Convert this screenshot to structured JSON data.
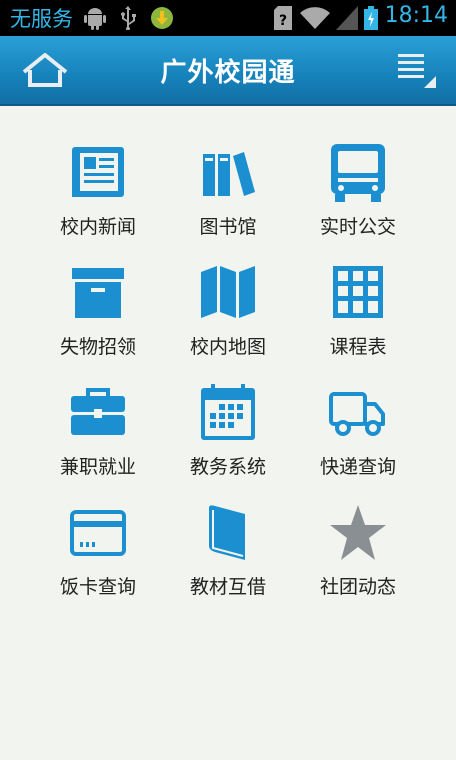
{
  "statusbar": {
    "carrier": "无服务",
    "time": "18:14",
    "icons": [
      "android-icon",
      "usb-icon",
      "download-icon",
      "unknown-sim-icon",
      "wifi-icon",
      "signal-icon",
      "battery-icon"
    ]
  },
  "appbar": {
    "title": "广外校园通",
    "home_icon": "home-icon",
    "menu_icon": "menu-icon"
  },
  "colors": {
    "appbar": "#1784bd",
    "tile_icon": "#1b8fd0",
    "star_icon": "#8a8f94",
    "background": "#f2f5ef",
    "status_text": "#33b5e5"
  },
  "tiles": [
    {
      "label": "校内新闻",
      "icon": "newspaper-icon"
    },
    {
      "label": "图书馆",
      "icon": "books-icon"
    },
    {
      "label": "实时公交",
      "icon": "bus-icon"
    },
    {
      "label": "失物招领",
      "icon": "box-icon"
    },
    {
      "label": "校内地图",
      "icon": "map-icon"
    },
    {
      "label": "课程表",
      "icon": "grid-icon"
    },
    {
      "label": "兼职就业",
      "icon": "briefcase-icon"
    },
    {
      "label": "教务系统",
      "icon": "calendar-icon"
    },
    {
      "label": "快递查询",
      "icon": "truck-icon"
    },
    {
      "label": "饭卡查询",
      "icon": "card-icon"
    },
    {
      "label": "教材互借",
      "icon": "book-icon"
    },
    {
      "label": "社团动态",
      "icon": "star-icon"
    }
  ]
}
